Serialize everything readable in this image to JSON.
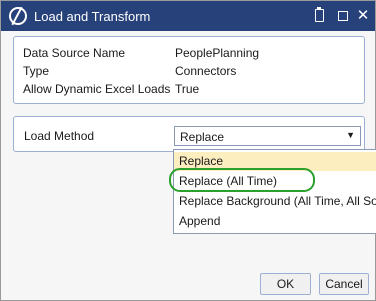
{
  "window": {
    "title": "Load and Transform",
    "icons": {
      "app": "app-logo-icon",
      "document": "document-icon",
      "maximize": "maximize-icon",
      "close": "close-icon"
    },
    "close_glyph": "✕"
  },
  "properties": {
    "rows": [
      {
        "label": "Data Source Name",
        "value": "PeoplePlanning"
      },
      {
        "label": "Type",
        "value": "Connectors"
      },
      {
        "label": "Allow Dynamic Excel Loads",
        "value": "True"
      }
    ]
  },
  "load_method": {
    "label": "Load Method",
    "selected": "Replace",
    "arrow": "▼",
    "options": [
      "Replace",
      "Replace (All Time)",
      "Replace Background (All Time, All Source IDs)",
      "Append"
    ]
  },
  "buttons": {
    "ok": "OK",
    "cancel": "Cancel"
  },
  "colors": {
    "titlebar": "#27427a",
    "highlight_item": "#fdeec0",
    "annotation_oval": "#2ca02c"
  }
}
